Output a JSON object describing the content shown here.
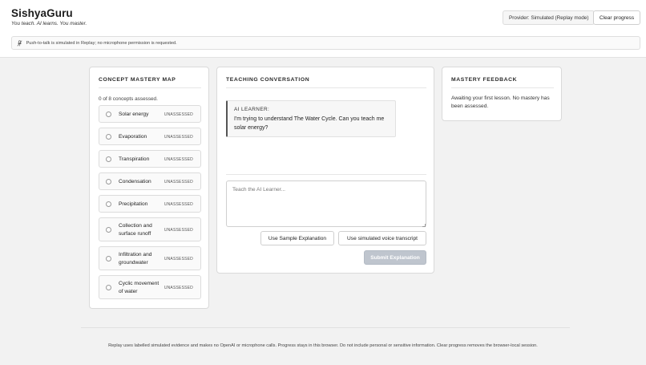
{
  "header": {
    "brand": "SishyaGuru",
    "tagline": "You teach. AI learns. You master.",
    "provider": "Provider: Simulated (Replay mode)",
    "clear_progress": "Clear progress",
    "notice": "Push-to-talk is simulated in Replay; no microphone permission is requested."
  },
  "concept_panel": {
    "title": "Concept Mastery Map",
    "assessed": "0 of 8 concepts assessed.",
    "items": [
      {
        "name": "Solar energy",
        "status": "UNASSESSED"
      },
      {
        "name": "Evaporation",
        "status": "UNASSESSED"
      },
      {
        "name": "Transpiration",
        "status": "UNASSESSED"
      },
      {
        "name": "Condensation",
        "status": "UNASSESSED"
      },
      {
        "name": "Precipitation",
        "status": "UNASSESSED"
      },
      {
        "name": "Collection and surface runoff",
        "status": "UNASSESSED"
      },
      {
        "name": "Infiltration and groundwater",
        "status": "UNASSESSED"
      },
      {
        "name": "Cyclic movement of water",
        "status": "UNASSESSED"
      }
    ]
  },
  "teaching_panel": {
    "title": "Teaching Conversation",
    "ai_label": "AI Learner:",
    "ai_message": "I'm trying to understand The Water Cycle. Can you teach me solar energy?",
    "input_placeholder": "Teach the AI Learner...",
    "sample_button": "Use Sample Explanation",
    "voice_button": "Use simulated voice transcript",
    "submit_button": "Submit Explanation"
  },
  "feedback_panel": {
    "title": "Mastery Feedback",
    "text": "Awaiting your first lesson. No mastery has been assessed."
  },
  "footer": {
    "text": "Replay uses labelled simulated evidence and makes no OpenAI or microphone calls. Progress stays in this browser. Do not include personal or sensitive information. Clear progress removes the browser-local session."
  }
}
